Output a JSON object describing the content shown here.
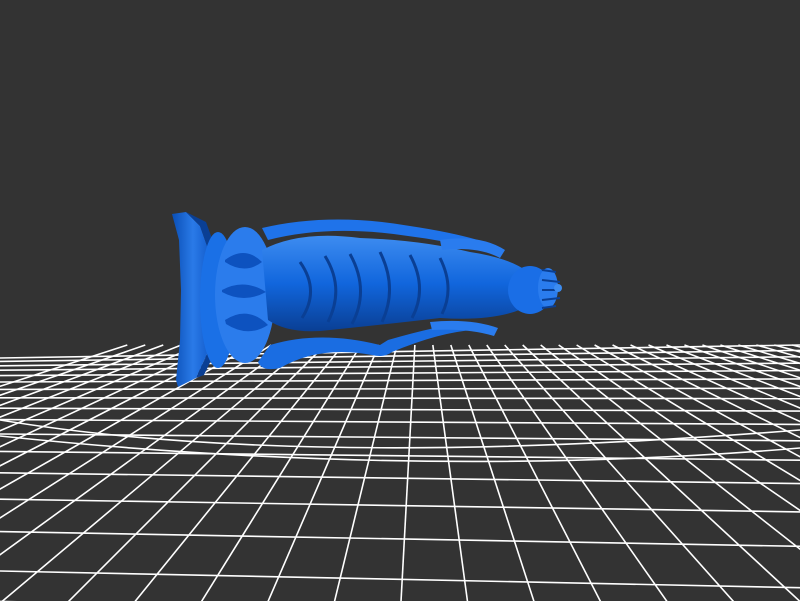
{
  "viewer": {
    "background_color": "#333333",
    "grid_color": "#ffffff",
    "model_color": "#1166dd",
    "model_highlight_color": "#3d8cf0",
    "model_shadow_color": "#0a3f94"
  },
  "scene": {
    "model": "statue-icon",
    "ground": "grid-floor"
  }
}
